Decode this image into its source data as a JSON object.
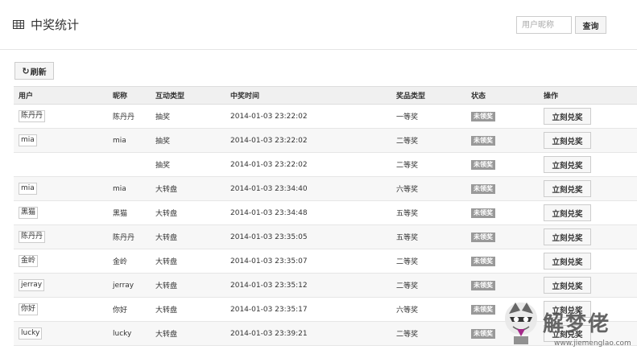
{
  "header": {
    "icon": "table-icon",
    "title": "中奖统计",
    "search_placeholder": "用户昵称",
    "query_label": "查询"
  },
  "toolbar": {
    "refresh_icon": "refresh-icon",
    "refresh_glyph": "↻",
    "refresh_label": "刷新"
  },
  "table": {
    "columns": [
      "用户",
      "昵称",
      "互动类型",
      "中奖时间",
      "奖品类型",
      "状态",
      "操作"
    ],
    "rows": [
      {
        "user": "陈丹丹",
        "nickname": "陈丹丹",
        "type": "抽奖",
        "time": "2014-01-03 23:22:02",
        "prize": "一等奖",
        "status": "未领奖",
        "action": "立刻兑奖"
      },
      {
        "user": "mia",
        "nickname": "mia",
        "type": "抽奖",
        "time": "2014-01-03 23:22:02",
        "prize": "二等奖",
        "status": "未领奖",
        "action": "立刻兑奖"
      },
      {
        "user": "",
        "nickname": "",
        "type": "抽奖",
        "time": "2014-01-03 23:22:02",
        "prize": "二等奖",
        "status": "未领奖",
        "action": "立刻兑奖"
      },
      {
        "user": "mia",
        "nickname": "mia",
        "type": "大转盘",
        "time": "2014-01-03 23:34:40",
        "prize": "六等奖",
        "status": "未领奖",
        "action": "立刻兑奖"
      },
      {
        "user": "黑猫",
        "nickname": "黑猫",
        "type": "大转盘",
        "time": "2014-01-03 23:34:48",
        "prize": "五等奖",
        "status": "未领奖",
        "action": "立刻兑奖"
      },
      {
        "user": "陈丹丹",
        "nickname": "陈丹丹",
        "type": "大转盘",
        "time": "2014-01-03 23:35:05",
        "prize": "五等奖",
        "status": "未领奖",
        "action": "立刻兑奖"
      },
      {
        "user": "金岭",
        "nickname": "金岭",
        "type": "大转盘",
        "time": "2014-01-03 23:35:07",
        "prize": "二等奖",
        "status": "未领奖",
        "action": "立刻兑奖"
      },
      {
        "user": "jerray",
        "nickname": "jerray",
        "type": "大转盘",
        "time": "2014-01-03 23:35:12",
        "prize": "二等奖",
        "status": "未领奖",
        "action": "立刻兑奖"
      },
      {
        "user": "你好",
        "nickname": "你好",
        "type": "大转盘",
        "time": "2014-01-03 23:35:17",
        "prize": "六等奖",
        "status": "未领奖",
        "action": "立刻兑奖"
      },
      {
        "user": "lucky",
        "nickname": "lucky",
        "type": "大转盘",
        "time": "2014-01-03 23:39:21",
        "prize": "二等奖",
        "status": "未领奖",
        "action": "立刻兑奖"
      }
    ]
  },
  "watermark": {
    "text": "解梦佬",
    "url": "www.jiemenglao.com"
  },
  "colors": {
    "status_badge": "#999999",
    "header_bg": "#f0f0f0",
    "alt_row_bg": "#f7f7f7"
  }
}
